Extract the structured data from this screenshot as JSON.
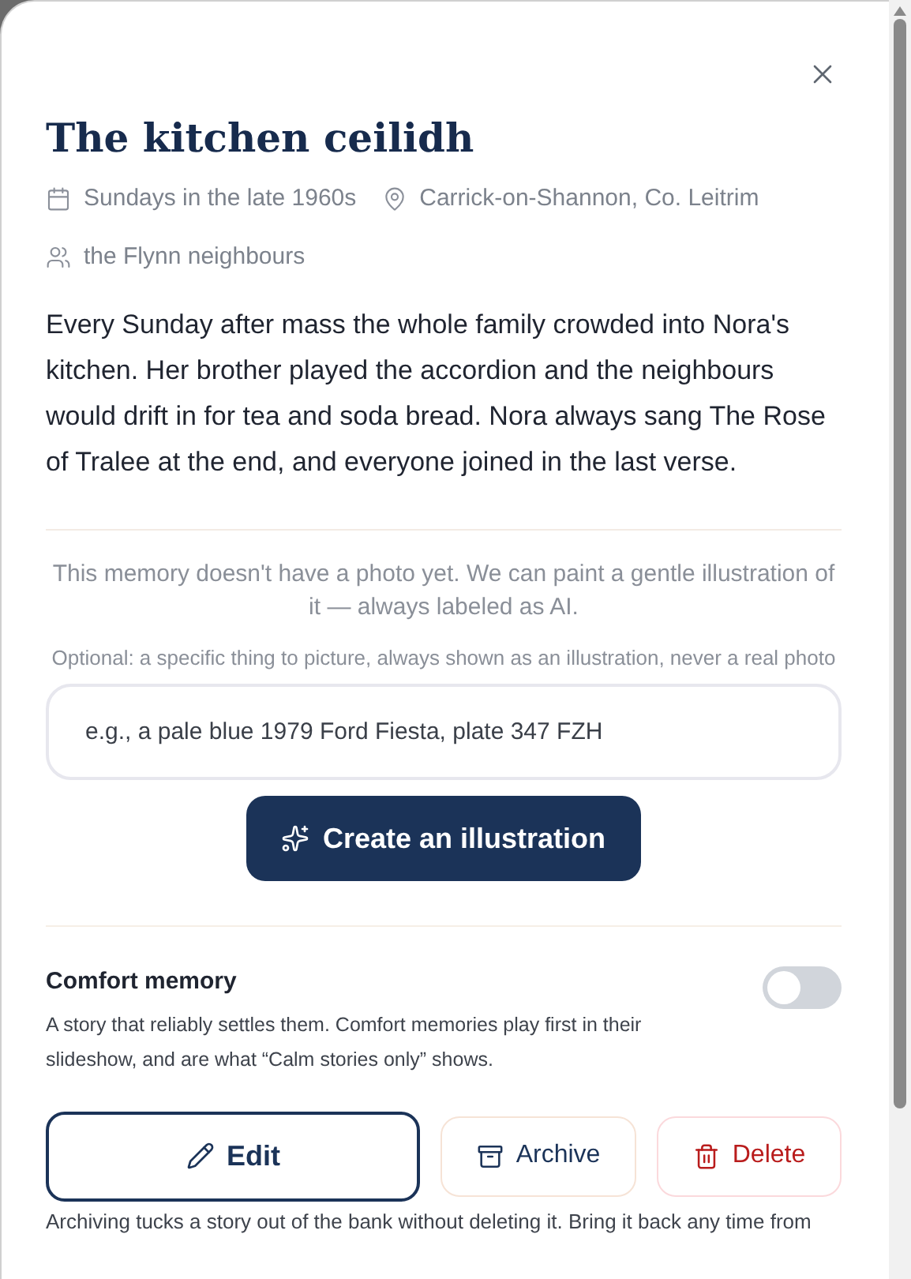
{
  "title": "The kitchen ceilidh",
  "meta": [
    {
      "kind": "date",
      "text": "Sundays in the late 1960s"
    },
    {
      "kind": "place",
      "text": "Carrick-on-Shannon, Co. Leitrim"
    },
    {
      "kind": "people",
      "text": "the Flynn neighbours"
    }
  ],
  "story": "Every Sunday after mass the whole family crowded into Nora's kitchen. Her brother played the accordion and the neighbours would drift in for tea and soda bread. Nora always sang The Rose of Tralee at the end, and everyone joined in the last verse.",
  "illustration": {
    "notice": "This memory doesn't have a photo yet. We can paint a gentle illustration of it — always labeled as AI.",
    "hint": "Optional: a specific thing to picture, always shown as an illustration, never a real photo",
    "placeholder": "e.g., a pale blue 1979 Ford Fiesta, plate 347 FZH",
    "button": "Create an illustration"
  },
  "comfort": {
    "label": "Comfort memory",
    "description": "A story that reliably settles them. Comfort memories play first in their slideshow, and are what “Calm stories only” shows.",
    "on": false
  },
  "actions": [
    {
      "kind": "edit",
      "label": "Edit"
    },
    {
      "kind": "archive",
      "label": "Archive"
    },
    {
      "kind": "delete",
      "label": "Delete"
    }
  ],
  "footer": "Archiving tucks a story out of the bank without deleting it. Bring it back any time from"
}
